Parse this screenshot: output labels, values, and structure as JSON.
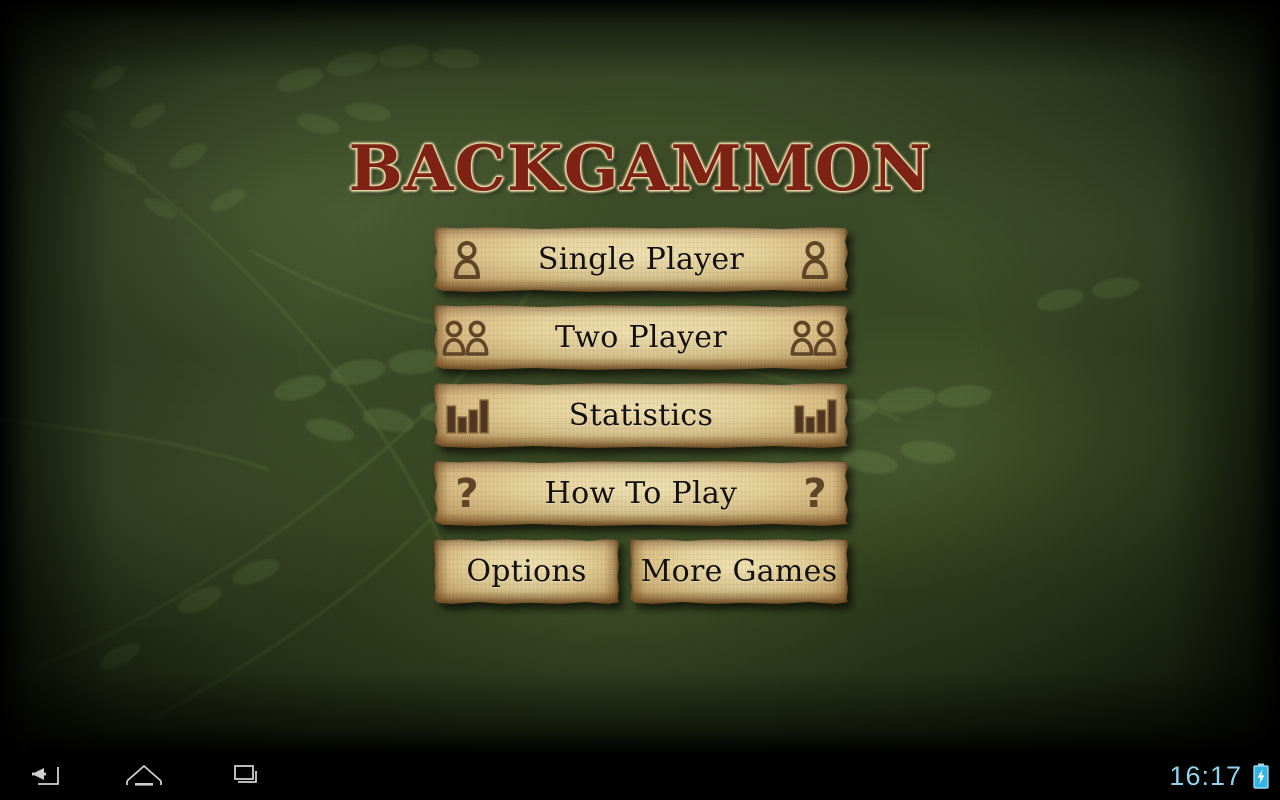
{
  "app": {
    "title": "BACKGAMMON",
    "title_color": "#7e2216",
    "title_outline_color": "#e8d9a8",
    "background_color": "#3a4a28",
    "button_paper_color": "#e6d39c",
    "button_text_color": "#14110c",
    "icon_color": "#5f4427"
  },
  "menu": {
    "items": [
      {
        "label": "Single Player",
        "icon_left": "person-icon",
        "icon_right": "person-icon",
        "size": "wide"
      },
      {
        "label": "Two Player",
        "icon_left": "two-people-icon",
        "icon_right": "two-people-icon",
        "size": "wide"
      },
      {
        "label": "Statistics",
        "icon_left": "bar-chart-icon",
        "icon_right": "bar-chart-icon",
        "size": "wide"
      },
      {
        "label": "How To Play",
        "icon_left": "question-mark-icon",
        "icon_right": "question-mark-icon",
        "size": "wide"
      },
      {
        "label": "Options",
        "icon_left": null,
        "icon_right": null,
        "size": "small"
      },
      {
        "label": "More Games",
        "icon_left": null,
        "icon_right": null,
        "size": "small"
      }
    ]
  },
  "nav_bar": {
    "back_icon": "back-arrow-icon",
    "home_icon": "home-icon",
    "recents_icon": "recent-apps-icon",
    "clock": "16:17",
    "clock_color": "#8fd3f0",
    "battery_icon": "battery-charging-icon",
    "battery_color": "#33b5e5"
  }
}
